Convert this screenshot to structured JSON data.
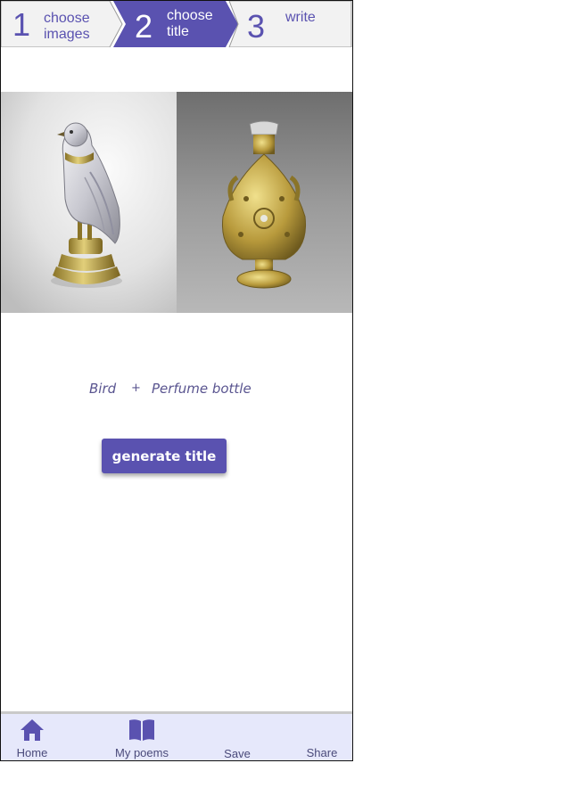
{
  "stepper": {
    "steps": [
      {
        "number": "1",
        "label_line1": "choose",
        "label_line2": "images",
        "state": "inactive"
      },
      {
        "number": "2",
        "label_line1": "choose",
        "label_line2": "title",
        "state": "active"
      },
      {
        "number": "3",
        "label_line1": "write",
        "label_line2": "",
        "state": "inactive"
      }
    ]
  },
  "selection": {
    "first": "Bird",
    "joiner": "+",
    "second": "Perfume bottle"
  },
  "actions": {
    "generate_label": "generate title"
  },
  "bottom_nav": {
    "items": [
      {
        "label": "Home",
        "icon": "home-icon"
      },
      {
        "label": "My poems",
        "icon": "open-book-icon"
      },
      {
        "label": "Save",
        "icon": ""
      },
      {
        "label": "Share",
        "icon": ""
      }
    ]
  },
  "colors": {
    "accent": "#5a52b0",
    "inactive_step_bg": "#f2f2f2",
    "nav_bg": "#e6e8fb",
    "caption_text": "#5a5590"
  }
}
